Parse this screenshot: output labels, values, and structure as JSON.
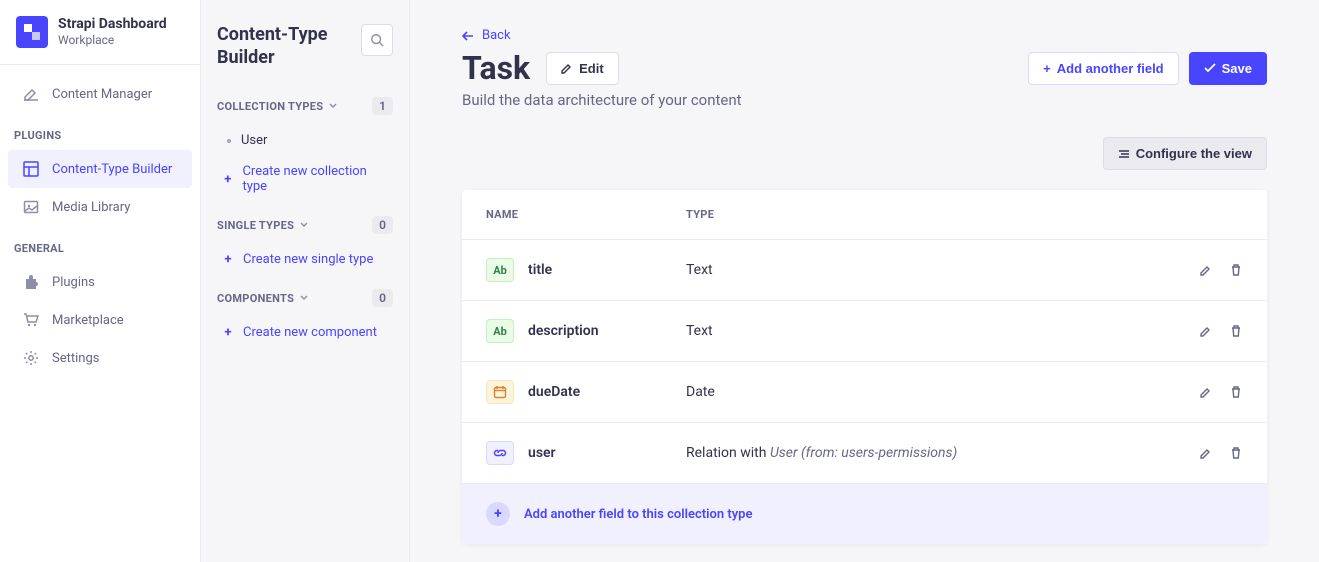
{
  "brand": {
    "title": "Strapi Dashboard",
    "subtitle": "Workplace"
  },
  "mainNav": {
    "contentManager": "Content Manager",
    "pluginsLabel": "PLUGINS",
    "ctb": "Content-Type Builder",
    "mediaLibrary": "Media Library",
    "generalLabel": "GENERAL",
    "plugins": "Plugins",
    "marketplace": "Marketplace",
    "settings": "Settings"
  },
  "subNav": {
    "title": "Content-Type Builder",
    "collectionTypes": {
      "label": "COLLECTION TYPES",
      "count": "1",
      "items": [
        "User"
      ],
      "create": "Create new collection type"
    },
    "singleTypes": {
      "label": "SINGLE TYPES",
      "count": "0",
      "create": "Create new single type"
    },
    "components": {
      "label": "COMPONENTS",
      "count": "0",
      "create": "Create new component"
    }
  },
  "page": {
    "back": "Back",
    "title": "Task",
    "editBtn": "Edit",
    "addFieldBtn": "Add another field",
    "saveBtn": "Save",
    "subtitle": "Build the data architecture of your content",
    "configureBtn": "Configure the view",
    "table": {
      "headers": {
        "name": "NAME",
        "type": "TYPE"
      },
      "rows": [
        {
          "iconClass": "ic-text",
          "iconText": "Ab",
          "name": "title",
          "type": "Text",
          "relation": ""
        },
        {
          "iconClass": "ic-text",
          "iconText": "Ab",
          "name": "description",
          "type": "Text",
          "relation": ""
        },
        {
          "iconClass": "ic-date",
          "iconText": "",
          "name": "dueDate",
          "type": "Date",
          "relation": ""
        },
        {
          "iconClass": "ic-rel",
          "iconText": "",
          "name": "user",
          "type": "Relation with ",
          "relation": "User (from: users-permissions)"
        }
      ],
      "addRow": "Add another field to this collection type"
    }
  }
}
